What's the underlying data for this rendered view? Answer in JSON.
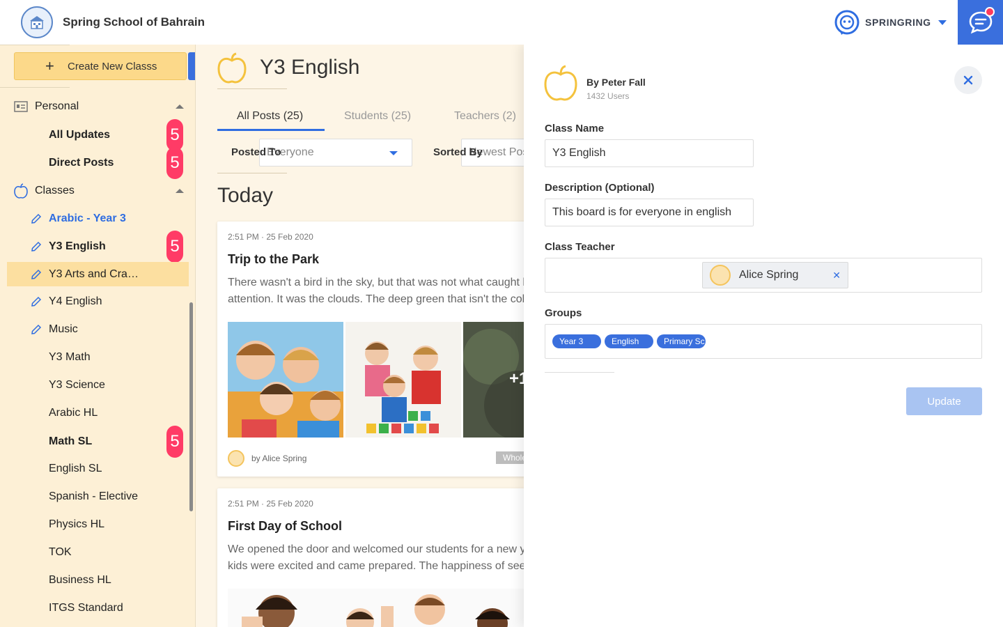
{
  "header": {
    "school_name": "Spring School of Bahrain",
    "brand": "SPRINGRING"
  },
  "sidebar": {
    "create_label": "Create New Classs",
    "personal": {
      "label": "Personal"
    },
    "items": [
      {
        "label": "All Updates",
        "badge": "5"
      },
      {
        "label": "Direct Posts",
        "badge": "5"
      }
    ],
    "classes_label": "Classes",
    "classes": [
      {
        "label": "Arabic - Year 3"
      },
      {
        "label": "Y3 English",
        "badge": "5"
      },
      {
        "label": "Y3 Arts and Cra…"
      },
      {
        "label": "Y4 English"
      },
      {
        "label": "Music"
      },
      {
        "label": "Y3 Math"
      },
      {
        "label": "Y3 Science"
      },
      {
        "label": "Arabic HL"
      },
      {
        "label": "Math SL",
        "badge": "5"
      },
      {
        "label": "English SL"
      },
      {
        "label": "Spanish - Elective"
      },
      {
        "label": "Physics HL"
      },
      {
        "label": "TOK"
      },
      {
        "label": "Business HL"
      },
      {
        "label": "ITGS Standard"
      }
    ]
  },
  "main": {
    "title": "Y3 English",
    "tabs": [
      {
        "label": "All Posts (25)"
      },
      {
        "label": "Students (25)"
      },
      {
        "label": "Teachers (2)"
      }
    ],
    "filters": {
      "posted_to_label": "Posted To",
      "posted_to_value": "Everyone",
      "sorted_by_label": "Sorted By",
      "sorted_by_value": "Newest Posts"
    },
    "today_label": "Today",
    "posts": [
      {
        "meta": "2:51 PM · 25 Feb 2020",
        "title": "Trip to the Park",
        "line1": "There wasn't a bird in the sky, but that was not what caught h",
        "line2": "attention. It was the clouds. The deep green that isn't the colo",
        "author": "by Alice Spring",
        "tag": "Whole",
        "more": "+1"
      },
      {
        "meta": "2:51 PM · 25 Feb 2020",
        "title": "First Day of School",
        "line1": "We opened the door and welcomed our students for a new y",
        "line2": "kids were excited and came prepared. The happiness of see"
      }
    ]
  },
  "panel": {
    "by_line": "By Peter Fall",
    "users": "1432 Users",
    "class_name_label": "Class Name",
    "class_name_value": "Y3 English",
    "description_label": "Description (Optional)",
    "description_value": "This board is for everyone in english",
    "teacher_label": "Class Teacher",
    "teacher_name": "Alice Spring",
    "groups_label": "Groups",
    "groups": [
      "Year 3",
      "English",
      "Primary Sc"
    ],
    "update_label": "Update"
  },
  "colors": {
    "accent": "#3a6fdd",
    "badge": "#ff3b66",
    "sidebar_bg": "#fdf0d6",
    "create_button": "#fcd98a",
    "apple": "#f4c23d"
  }
}
